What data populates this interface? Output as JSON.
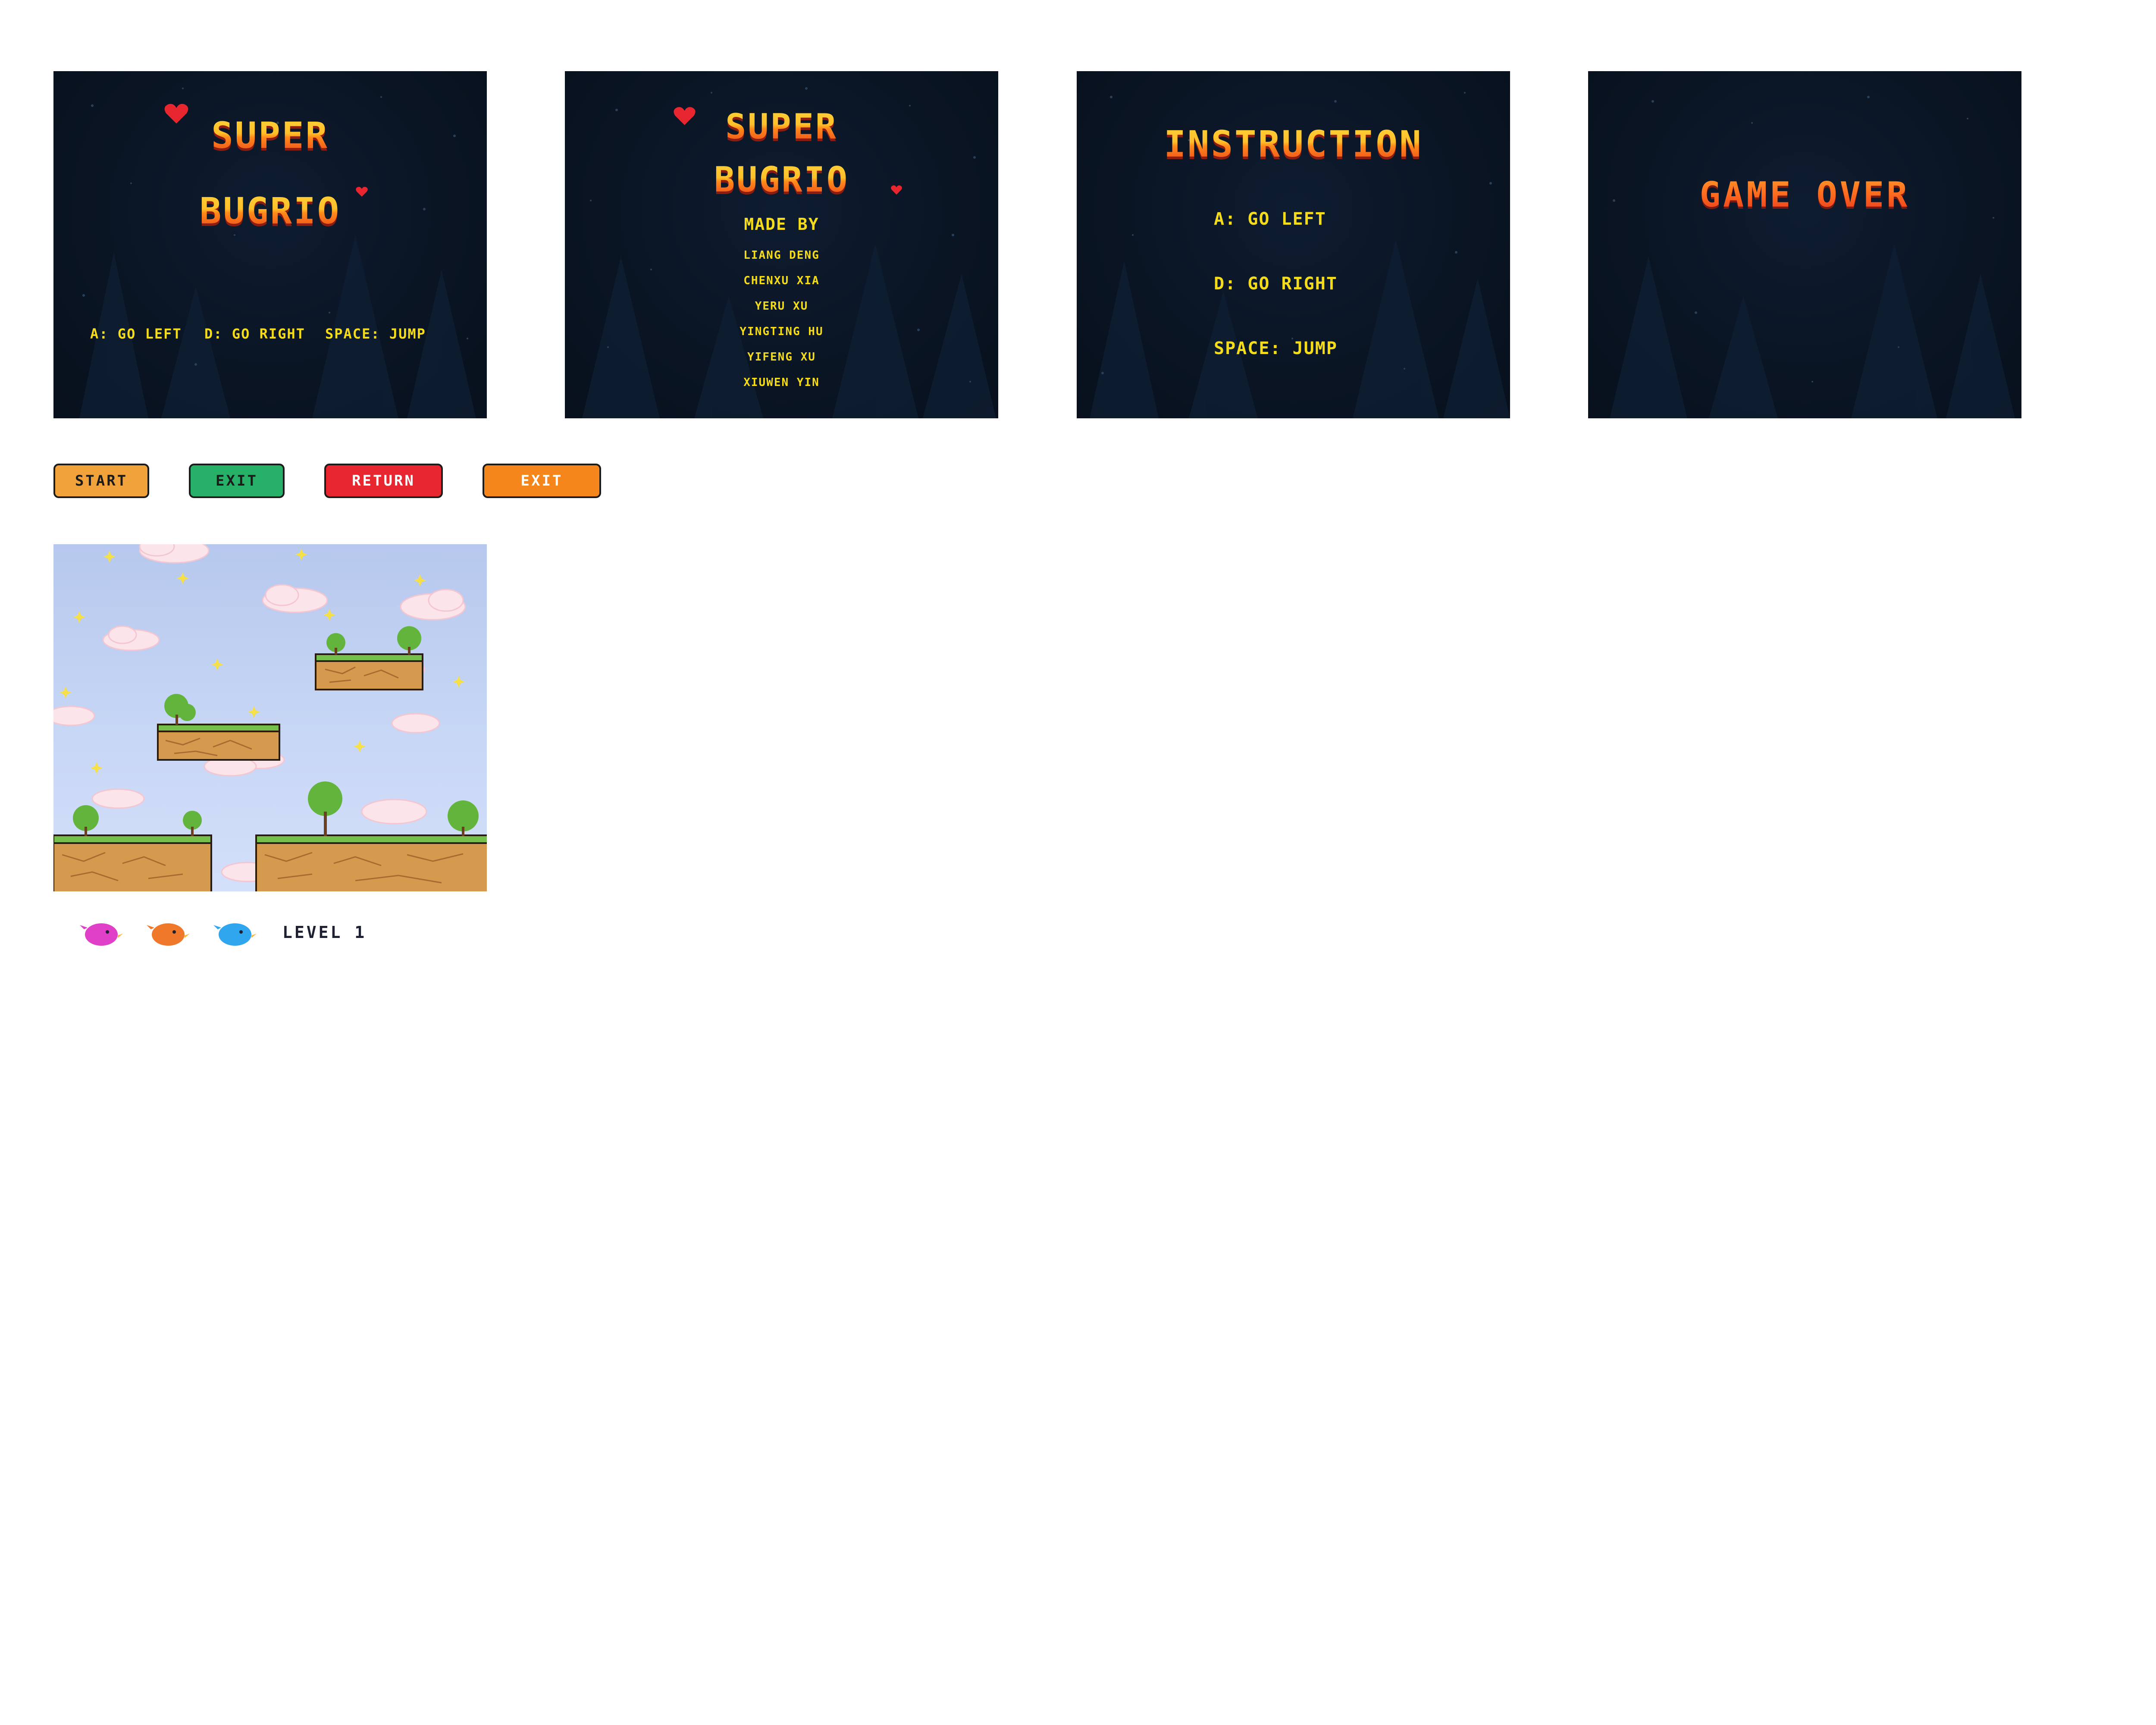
{
  "screens": {
    "title": {
      "title_line1": "SUPER",
      "title_line2": "BUGRIO",
      "controls": [
        "A: GO LEFT",
        "D: GO RIGHT",
        "SPACE: JUMP"
      ]
    },
    "credits": {
      "title_line1": "SUPER",
      "title_line2": "BUGRIO",
      "made_by": "MADE BY",
      "names": [
        "LIANG DENG",
        "CHENXU XIA",
        "YERU XU",
        "YINGTING HU",
        "YIFENG XU",
        "XIUWEN YIN"
      ]
    },
    "instruction": {
      "title": "INSTRUCTION",
      "lines": [
        "A: GO LEFT",
        "D: GO RIGHT",
        "SPACE: JUMP"
      ]
    },
    "game_over": {
      "title": "GAME OVER"
    }
  },
  "buttons": [
    {
      "label": "START",
      "color": "#f2a23a",
      "text_color": "#1b1b1b"
    },
    {
      "label": "EXIT",
      "color": "#27b168",
      "text_color": "#1b1b1b"
    },
    {
      "label": "RETURN",
      "color": "#e8262f",
      "text_color": "#ffffff"
    },
    {
      "label": "EXIT",
      "color": "#f5861c",
      "text_color": "#ffffff"
    }
  ],
  "hud": {
    "lives": [
      {
        "icon": "pink-bird-icon",
        "color": "#e040c8"
      },
      {
        "icon": "orange-bird-icon",
        "color": "#f0782a"
      },
      {
        "icon": "blue-bird-icon",
        "color": "#2fa6ee"
      }
    ],
    "level": "LEVEL 1"
  },
  "colors": {
    "panel_bg": "#0a1524",
    "title_yellow": "#ffc02a",
    "title_red": "#e8401e",
    "menu_text": "#f4dc1c",
    "sky": "#c4d4f4"
  }
}
